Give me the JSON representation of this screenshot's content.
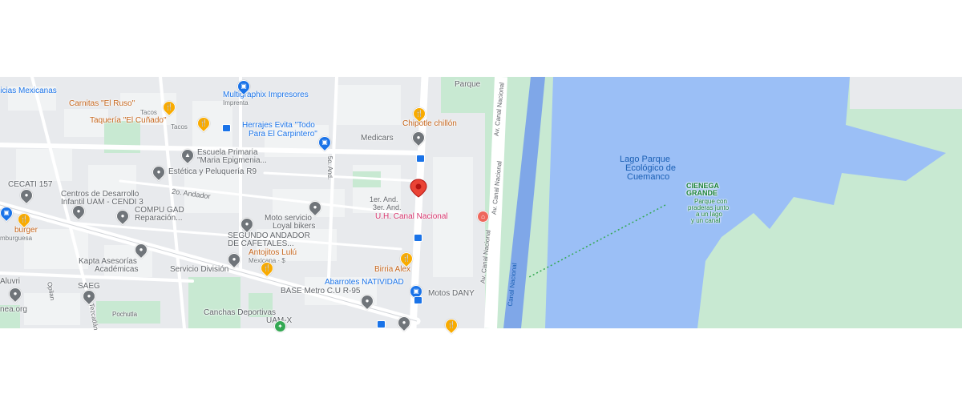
{
  "map": {
    "colors": {
      "water": "#9bbff6",
      "park": "#c8e9d2",
      "road": "#ffffff",
      "block": "#e8eaed",
      "pin": "#ea4335"
    },
    "labels": {
      "noticias": "licias Mexicanas",
      "carnitas": "Carnitas \"El Ruso\"",
      "carnitas_sub": "Tacos",
      "taqueria": "Taquería \"El Cuñado\"",
      "taqueria_sub": "Tacos",
      "multigraphix": "Multigraphix Impresores",
      "multigraphix_sub": "Imprenta",
      "parque": "Parque",
      "herrajes": "Herrajes Evita \"Todo",
      "herrajes2": "Para El Carpintero\"",
      "chipotle": "Chipotle chillón",
      "medicars": "Medicars",
      "escuela": "Escuela Primaria",
      "escuela2": "\"Maria Epigmenia...",
      "estetica": "Estética y Peluquería R9",
      "cecati": "CECATI 157",
      "centros": "Centros de Desarrollo",
      "centros2": "Infantil UAM - CENDI 3",
      "andador2": "2o. Andador",
      "andador5": "5o. And.",
      "and1": "1er. And.",
      "and3": "3er. And.",
      "compu": "COMPU GAD",
      "compu2": "Reparación...",
      "moto": "Moto servicio",
      "moto2": "Loyal bikers",
      "uh": "U.H. Canal Nacional",
      "burger": "burger",
      "burger_sub": "mburguesa",
      "segundo": "SEGUNDO ANDADOR",
      "segundo2": "DE CAFETALES...",
      "antojitos": "Antojitos Lulú",
      "antojitos_sub": "Mexicana · $",
      "kapta": "Kapta Asesorías",
      "kapta2": "Académicas",
      "servicio": "Servicio División",
      "birria": "Birria Alex",
      "aluvri": "Aluvri",
      "abarrotes": "Abarrotes NATIVIDAD",
      "saeg": "SAEG",
      "base": "BASE Metro C.U R-95",
      "motos_dany": "Motos DANY",
      "pochutla": "Pochutla",
      "nea": "nea.org",
      "canchas": "Canchas Deportivas",
      "canchas2": "UAM-X",
      "opilan": "Opilan",
      "tezcatlan": "Tezcatlán",
      "av_canal_1": "Av. Canal Nacional",
      "av_canal_2": "Av. Canal Nacional",
      "av_canal_3": "Av. Canal Nacional",
      "canal": "Canal Nacional",
      "lago": "Lago Parque",
      "lago2": "Ecológico de",
      "lago3": "Cuemanco",
      "cienega": "CIENEGA",
      "cienega2": "GRANDE",
      "cienega_sub": "Parque con",
      "cienega_sub2": "praderas junto",
      "cienega_sub3": "a un lago",
      "cienega_sub4": "y un canal"
    }
  }
}
